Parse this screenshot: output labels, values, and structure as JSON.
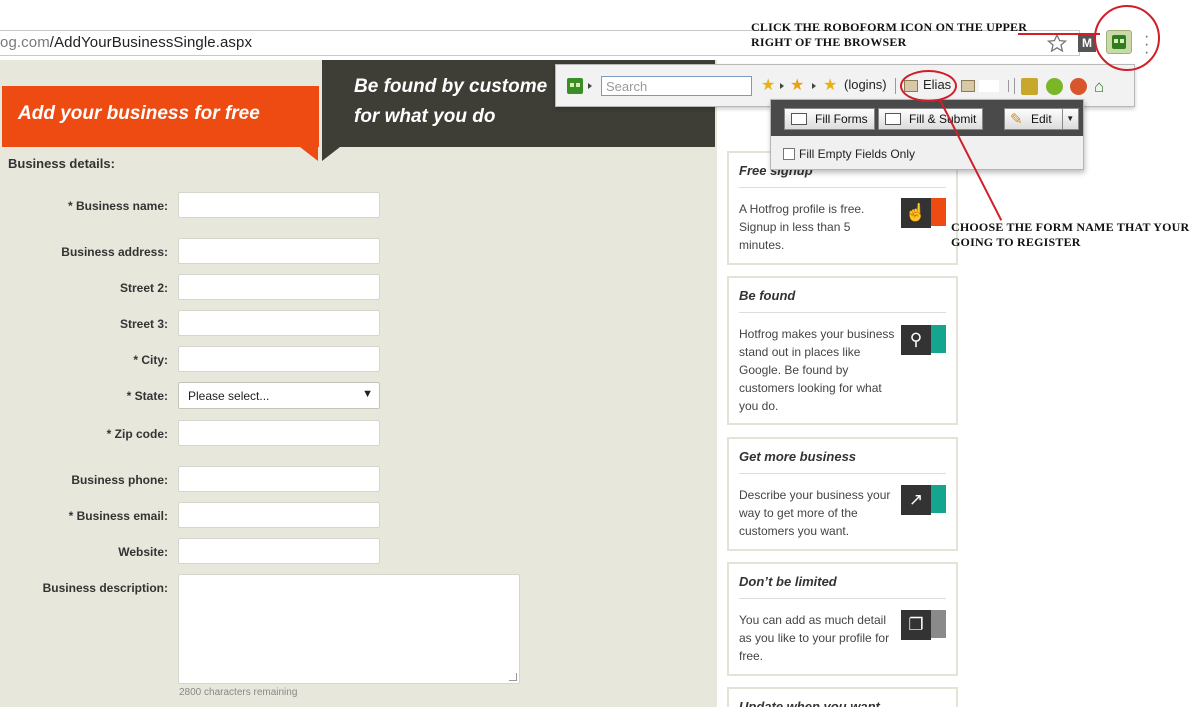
{
  "browser": {
    "url_prefix": "og.com",
    "url_path": "/AddYourBusinessSingle.aspx"
  },
  "annotations": {
    "top": "CLICK THE ROBOFORM ICON ON THE UPPER RIGHT OF THE BROWSER",
    "middle": "CHOOSE THE FORM NAME THAT YOUR GOING TO REGISTER"
  },
  "hero": {
    "orange_title": "Add your business for free",
    "dark_line1": "Be found by custome",
    "dark_line2": "for what you do"
  },
  "form": {
    "section_title": "Business details:",
    "labels": {
      "business_name": "* Business name:",
      "business_address": "Business address:",
      "street2": "Street 2:",
      "street3": "Street 3:",
      "city": "* City:",
      "state": "* State:",
      "zip": "* Zip code:",
      "phone": "Business phone:",
      "email": "* Business email:",
      "website": "Website:",
      "description": "Business description:"
    },
    "state_selected": "Please select...",
    "chars_remaining": "2800 characters remaining"
  },
  "cards": [
    {
      "title": "Free signup",
      "body": "A Hotfrog profile is free. Signup in less than 5 minutes.",
      "icon": "hand-pointer-icon",
      "accent": "#ee4b12"
    },
    {
      "title": "Be found",
      "body": "Hotfrog makes your business stand out in places like Google. Be found by customers looking for what you do.",
      "icon": "magnifier-icon",
      "accent": "#13a58e"
    },
    {
      "title": "Get more business",
      "body": "Describe your business your way to get more of the customers you want.",
      "icon": "growth-chart-icon",
      "accent": "#13a58e"
    },
    {
      "title": "Don’t be limited",
      "body": "You can add as much detail as you like to your profile for free.",
      "icon": "documents-icon",
      "accent": "#8a8a8a"
    },
    {
      "title": "Update when you want"
    }
  ],
  "roboform": {
    "search_placeholder": "Search",
    "logins": "(logins)",
    "identity": "Elias",
    "fill_forms": "Fill Forms",
    "fill_submit": "Fill & Submit",
    "edit": "Edit",
    "fill_empty_only": "Fill Empty Fields Only"
  }
}
